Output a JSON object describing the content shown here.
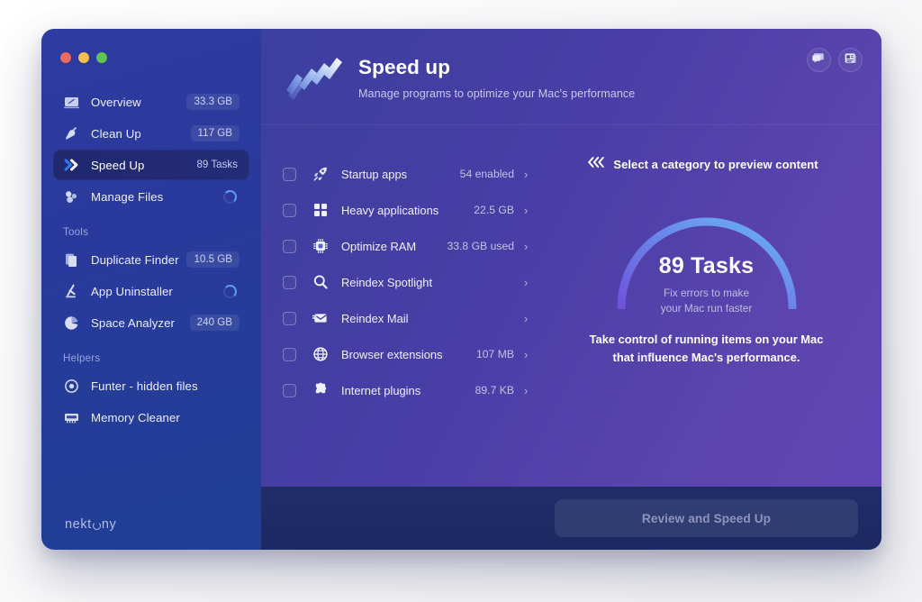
{
  "window": {
    "traffic_lights": [
      "close",
      "minimize",
      "zoom"
    ]
  },
  "sidebar": {
    "brand": "nekt ny",
    "brand_prefix": "nekt",
    "brand_suffix": "ny",
    "items": [
      {
        "label": "Overview",
        "value": "33.3 GB",
        "icon": "dashboard-icon",
        "state": "value"
      },
      {
        "label": "Clean Up",
        "value": "117 GB",
        "icon": "broom-icon",
        "state": "value"
      },
      {
        "label": "Speed Up",
        "value": "89 Tasks",
        "icon": "double-chevron-icon",
        "state": "value",
        "active": true
      },
      {
        "label": "Manage Files",
        "value": "",
        "icon": "files-icon",
        "state": "loading"
      }
    ],
    "sections": [
      {
        "title": "Tools",
        "items": [
          {
            "label": "Duplicate Finder",
            "value": "10.5 GB",
            "icon": "duplicate-icon",
            "state": "value"
          },
          {
            "label": "App Uninstaller",
            "value": "",
            "icon": "uninstaller-icon",
            "state": "loading"
          },
          {
            "label": "Space Analyzer",
            "value": "240 GB",
            "icon": "pie-chart-icon",
            "state": "value"
          }
        ]
      },
      {
        "title": "Helpers",
        "items": [
          {
            "label": "Funter - hidden files",
            "value": "",
            "icon": "target-icon",
            "state": "none"
          },
          {
            "label": "Memory Cleaner",
            "value": "",
            "icon": "memory-icon",
            "state": "none"
          }
        ]
      }
    ]
  },
  "header": {
    "title": "Speed up",
    "subtitle": "Manage programs to optimize your Mac's performance",
    "hero_icon": "speed-chevrons-icon",
    "actions": [
      {
        "icon": "feedback-bubble-icon",
        "name": "feedback-button"
      },
      {
        "icon": "news-panel-icon",
        "name": "news-button"
      }
    ]
  },
  "tasks": [
    {
      "label": "Startup apps",
      "value": "54 enabled",
      "icon": "rocket-icon",
      "checked": false
    },
    {
      "label": "Heavy applications",
      "value": "22.5 GB",
      "icon": "grid-icon",
      "checked": false
    },
    {
      "label": "Optimize RAM",
      "value": "33.8 GB used",
      "icon": "chip-icon",
      "checked": false
    },
    {
      "label": "Reindex Spotlight",
      "value": "",
      "icon": "search-icon",
      "checked": false
    },
    {
      "label": "Reindex Mail",
      "value": "",
      "icon": "mail-icon",
      "checked": false
    },
    {
      "label": "Browser extensions",
      "value": "107 MB",
      "icon": "globe-icon",
      "checked": false
    },
    {
      "label": "Internet plugins",
      "value": "89.7 KB",
      "icon": "puzzle-icon",
      "checked": false
    }
  ],
  "preview": {
    "hint": "Select a category to preview content",
    "hint_icon": "triple-chevron-left-icon",
    "gauge": {
      "value": "89 Tasks",
      "caption_line1": "Fix errors to make",
      "caption_line2": "your Mac run faster",
      "arc_start_color": "#6f52da",
      "arc_end_color": "#68b6f4"
    },
    "footer_line1": "Take control of running items on your Mac",
    "footer_line2": "that influence Mac's performance."
  },
  "footer": {
    "cta_label": "Review and Speed Up",
    "cta_enabled": false
  },
  "colors": {
    "sidebar_top": "#2e3ba0",
    "sidebar_bottom": "#1f3f95",
    "main_left": "#3b3f9e",
    "main_right": "#6247b4",
    "footer_bar": "#1e2c68",
    "active_row": "#20286e"
  }
}
